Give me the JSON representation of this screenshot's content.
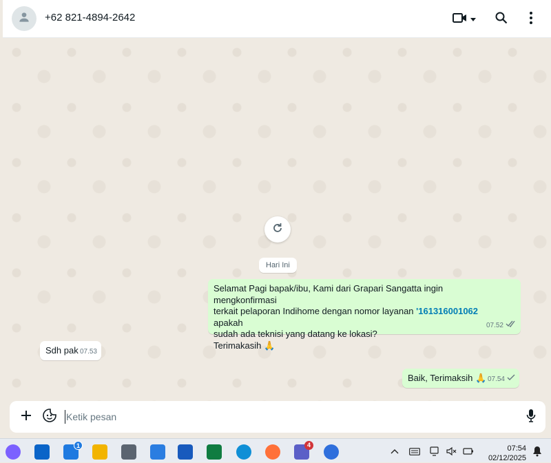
{
  "header": {
    "contact_name": "+62 821-4894-2642",
    "icons": [
      "person-icon",
      "video-call-icon",
      "chevron-down-icon",
      "search-icon",
      "more-vertical-icon"
    ]
  },
  "chat": {
    "day_label": "Hari Ini",
    "messages": [
      {
        "direction": "outgoing",
        "line1": "Selamat Pagi bapak/ibu, Kami dari Grapari Sangatta ingin mengkonfirmasi",
        "line2_pre": "terkait pelaporan Indihome dengan nomor layanan ",
        "line2_num": "'161316001062",
        "line2_post": " apakah",
        "line3": "sudah ada teknisi yang datang ke lokasi?",
        "line4": "Terimakasih 🙏",
        "time": "07.52",
        "status": "read"
      },
      {
        "direction": "incoming",
        "text": "Sdh pak",
        "time": "07.53"
      },
      {
        "direction": "outgoing",
        "text": "Baik, Terimaksih 🙏",
        "time": "07.54",
        "status": "sent"
      }
    ]
  },
  "composer": {
    "placeholder": "Ketik pesan",
    "value": ""
  },
  "taskbar": {
    "apps": [
      {
        "name": "copilot-icon",
        "color": "#7b61ff"
      },
      {
        "name": "outlook-icon",
        "color": "#0a64c8"
      },
      {
        "name": "microsoft-store-icon",
        "color": "#1f7ae0",
        "badge": "1"
      },
      {
        "name": "file-explorer-icon",
        "color": "#f2b400"
      },
      {
        "name": "calculator-icon",
        "color": "#5b6470"
      },
      {
        "name": "notepad-icon",
        "color": "#2a7de1"
      },
      {
        "name": "word-icon",
        "color": "#185abd"
      },
      {
        "name": "excel-icon",
        "color": "#107c41"
      },
      {
        "name": "edge-icon",
        "color": "#0f8fd6"
      },
      {
        "name": "firefox-icon",
        "color": "#ff7139"
      },
      {
        "name": "teams-icon",
        "color": "#5b5fc7",
        "badge": "4"
      },
      {
        "name": "media-player-icon",
        "color": "#2f6fdc"
      }
    ],
    "time": "07:54",
    "date": "02/12/2025"
  },
  "colors": {
    "accent": "#00a884",
    "outgoing_bubble": "#d9fdd3",
    "incoming_bubble": "#ffffff",
    "chat_background": "#efeae2",
    "read_tick": "#53bdeb"
  }
}
